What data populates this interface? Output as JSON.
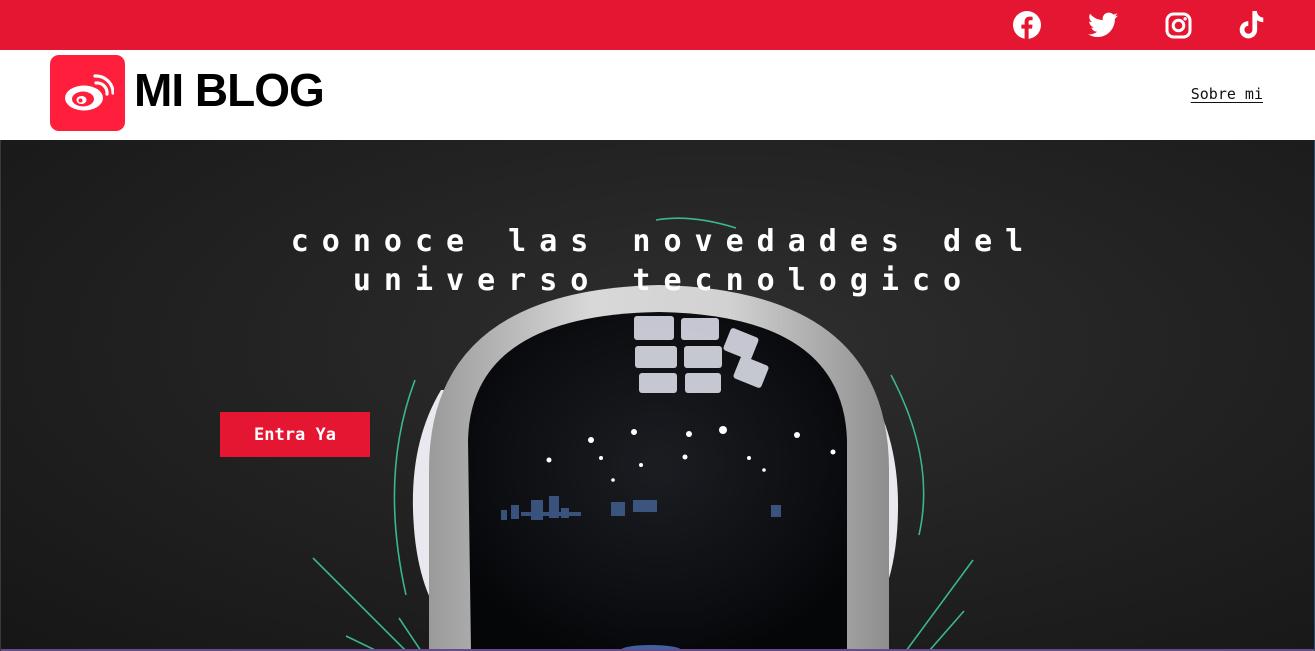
{
  "colors": {
    "accent": "#e51631",
    "logo_bg": "#ff1e3c",
    "hero_bg": "#1e1e1e"
  },
  "social": [
    {
      "name": "facebook",
      "icon": "facebook-icon"
    },
    {
      "name": "twitter",
      "icon": "twitter-icon"
    },
    {
      "name": "instagram",
      "icon": "instagram-icon"
    },
    {
      "name": "tiktok",
      "icon": "tiktok-icon"
    }
  ],
  "header": {
    "logo_icon": "weibo-icon",
    "brand": "MI BLOG",
    "nav_about": "Sobre mi"
  },
  "hero": {
    "title": "conoce las novedades del\nuniverso tecnologico",
    "cta_label": "Entra Ya",
    "image": "astronaut-helmet-image"
  }
}
